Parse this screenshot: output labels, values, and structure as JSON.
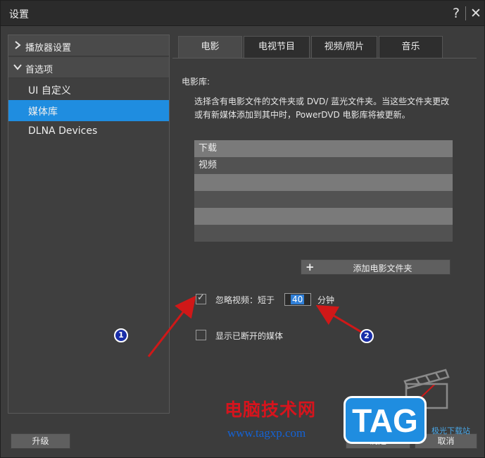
{
  "window": {
    "title": "设置",
    "help_glyph": "?",
    "close_glyph": "✕"
  },
  "sidebar": {
    "groups": [
      {
        "label": "播放器设置",
        "expanded": false
      },
      {
        "label": "首选项",
        "expanded": true
      }
    ],
    "items": [
      {
        "label": "UI 自定义",
        "active": false
      },
      {
        "label": "媒体库",
        "active": true
      },
      {
        "label": "DLNA Devices",
        "active": false
      }
    ]
  },
  "tabs": [
    {
      "label": "电影",
      "active": true
    },
    {
      "label": "电视节目",
      "active": false
    },
    {
      "label": "视频/照片",
      "active": false
    },
    {
      "label": "音乐",
      "active": false
    }
  ],
  "library": {
    "section_title": "电影库:",
    "description": "选择含有电影文件的文件夹或 DVD/ 蓝光文件夹。当这些文件夹更改或有新媒体添加到其中时，PowerDVD 电影库将被更新。",
    "folders": [
      "下载",
      "视频",
      "",
      "",
      "",
      ""
    ],
    "add_button_label": "添加电影文件夹"
  },
  "options": {
    "ignore_videos_label": "忽略视频：短于",
    "ignore_videos_checked": true,
    "ignore_minutes_value": "40",
    "minutes_unit": "分钟",
    "show_disconnected_label": "显示已断开的媒体",
    "show_disconnected_checked": false
  },
  "annotations": {
    "marker_1": "1",
    "marker_2": "2"
  },
  "footer": {
    "upgrade_label": "升级",
    "ok_label": "确定",
    "cancel_label": "取消"
  },
  "watermark": {
    "site_name": "电脑技术网",
    "url": "www.tagxp.com",
    "logo_text": "TAG",
    "small_text": "极光下载站"
  },
  "colors": {
    "accent": "#1f8de0",
    "annotation_arrow": "#d01818",
    "annotation_marker": "#1a2ea8"
  }
}
